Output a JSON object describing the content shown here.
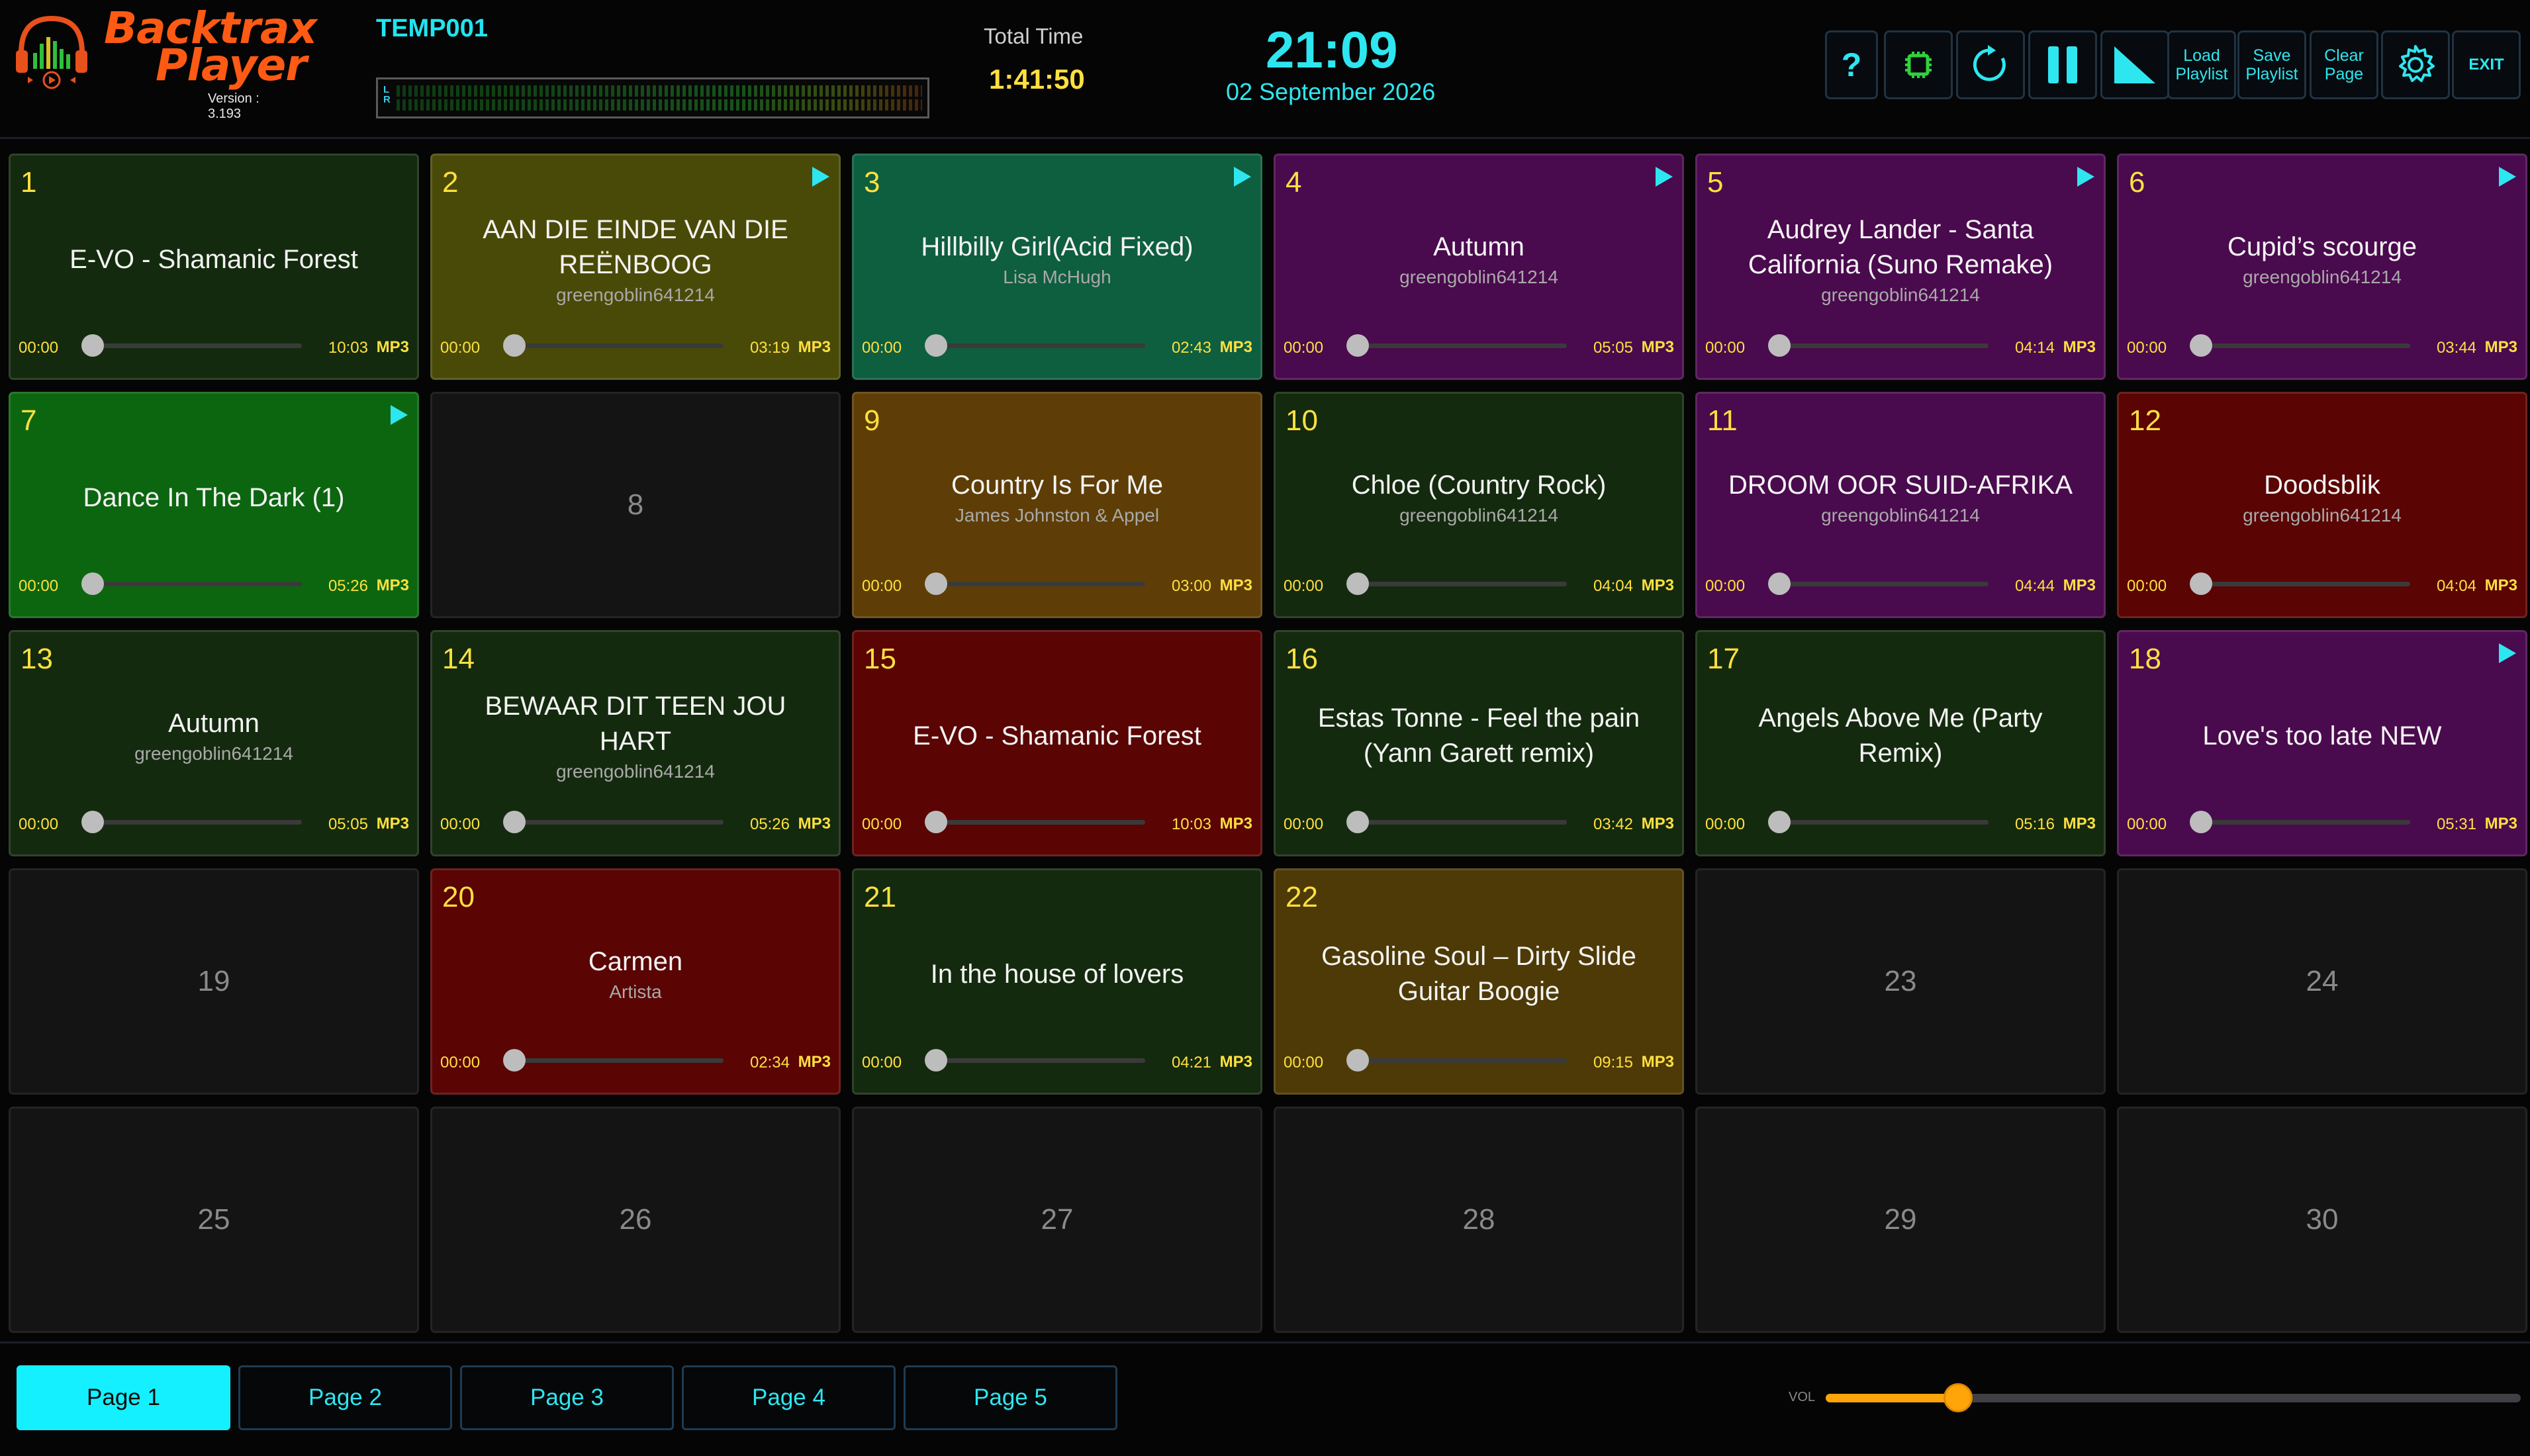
{
  "app": {
    "logo_line1": "Backtrax",
    "logo_line2": "Player",
    "version": "Version : 3.193",
    "playlist_name": "TEMP001",
    "meter_letters": "L\nR"
  },
  "status": {
    "total_time_label": "Total Time",
    "total_time": "1:41:50",
    "clock": "21:09",
    "date": "02 September 2026"
  },
  "toolbar": {
    "help_label": "?",
    "load_playlist": "Load\nPlaylist",
    "save_playlist": "Save\nPlaylist",
    "clear_page": "Clear\nPage",
    "exit": "EXIT",
    "icons": [
      "help-icon",
      "chip-icon",
      "refresh-icon",
      "pause-icon",
      "fade-icon",
      "settings-icon"
    ]
  },
  "colors": {
    "accent": "#2ee6f0",
    "yellow": "#ffe040",
    "volume": "#ffa50a",
    "dark_green": "#142a0e",
    "olive": "#4a4a08",
    "teal": "#0e5e40",
    "purple": "#4a0a4e",
    "bright_green": "#0c6610",
    "brown": "#5e3e06",
    "maroon": "#5a0404"
  },
  "grid": {
    "cells": [
      {
        "num": "1",
        "empty": false,
        "title": "E-VO - Shamanic Forest",
        "artist": "",
        "start": "00:00",
        "end": "10:03",
        "format": "MP3",
        "playing": false,
        "color": "#142a0e"
      },
      {
        "num": "2",
        "empty": false,
        "title": "AAN DIE EINDE VAN DIE REËNBOOG",
        "artist": "greengoblin641214",
        "start": "00:00",
        "end": "03:19",
        "format": "MP3",
        "playing": true,
        "color": "#4a4a08"
      },
      {
        "num": "3",
        "empty": false,
        "title": "Hillbilly Girl(Acid Fixed)",
        "artist": "Lisa McHugh",
        "start": "00:00",
        "end": "02:43",
        "format": "MP3",
        "playing": true,
        "color": "#0e5e40"
      },
      {
        "num": "4",
        "empty": false,
        "title": "Autumn",
        "artist": "greengoblin641214",
        "start": "00:00",
        "end": "05:05",
        "format": "MP3",
        "playing": true,
        "color": "#4a0a4e"
      },
      {
        "num": "5",
        "empty": false,
        "title": "Audrey Lander - Santa California (Suno Remake)",
        "artist": "greengoblin641214",
        "start": "00:00",
        "end": "04:14",
        "format": "MP3",
        "playing": true,
        "color": "#4a0a4e"
      },
      {
        "num": "6",
        "empty": false,
        "title": "Cupid’s scourge",
        "artist": "greengoblin641214",
        "start": "00:00",
        "end": "03:44",
        "format": "MP3",
        "playing": true,
        "color": "#4a0a4e"
      },
      {
        "num": "7",
        "empty": false,
        "title": "Dance In The Dark (1)",
        "artist": "",
        "start": "00:00",
        "end": "05:26",
        "format": "MP3",
        "playing": true,
        "color": "#0c6610"
      },
      {
        "num": "8",
        "empty": true
      },
      {
        "num": "9",
        "empty": false,
        "title": "Country Is For Me",
        "artist": "James Johnston & Appel",
        "start": "00:00",
        "end": "03:00",
        "format": "MP3",
        "playing": false,
        "color": "#5e3e06"
      },
      {
        "num": "10",
        "empty": false,
        "title": "Chloe (Country Rock)",
        "artist": "greengoblin641214",
        "start": "00:00",
        "end": "04:04",
        "format": "MP3",
        "playing": false,
        "color": "#142a0e"
      },
      {
        "num": "11",
        "empty": false,
        "title": "DROOM OOR SUID-AFRIKA",
        "artist": "greengoblin641214",
        "start": "00:00",
        "end": "04:44",
        "format": "MP3",
        "playing": false,
        "color": "#4a0a4e"
      },
      {
        "num": "12",
        "empty": false,
        "title": "Doodsblik",
        "artist": "greengoblin641214",
        "start": "00:00",
        "end": "04:04",
        "format": "MP3",
        "playing": false,
        "color": "#5a0404"
      },
      {
        "num": "13",
        "empty": false,
        "title": "Autumn",
        "artist": "greengoblin641214",
        "start": "00:00",
        "end": "05:05",
        "format": "MP3",
        "playing": false,
        "color": "#142a0e"
      },
      {
        "num": "14",
        "empty": false,
        "title": "BEWAAR DIT TEEN JOU HART",
        "artist": "greengoblin641214",
        "start": "00:00",
        "end": "05:26",
        "format": "MP3",
        "playing": false,
        "color": "#142a0e"
      },
      {
        "num": "15",
        "empty": false,
        "title": "E-VO - Shamanic Forest",
        "artist": "",
        "start": "00:00",
        "end": "10:03",
        "format": "MP3",
        "playing": false,
        "color": "#5a0404"
      },
      {
        "num": "16",
        "empty": false,
        "title": "Estas Tonne - Feel the pain (Yann Garett remix)",
        "artist": "",
        "start": "00:00",
        "end": "03:42",
        "format": "MP3",
        "playing": false,
        "color": "#142a0e"
      },
      {
        "num": "17",
        "empty": false,
        "title": "Angels Above Me (Party Remix)",
        "artist": "",
        "start": "00:00",
        "end": "05:16",
        "format": "MP3",
        "playing": false,
        "color": "#142a0e"
      },
      {
        "num": "18",
        "empty": false,
        "title": "Love's too late NEW",
        "artist": "",
        "start": "00:00",
        "end": "05:31",
        "format": "MP3",
        "playing": true,
        "color": "#4a0a4e"
      },
      {
        "num": "19",
        "empty": true
      },
      {
        "num": "20",
        "empty": false,
        "title": "Carmen",
        "artist": "Artista",
        "start": "00:00",
        "end": "02:34",
        "format": "MP3",
        "playing": false,
        "color": "#5a0404"
      },
      {
        "num": "21",
        "empty": false,
        "title": "In the house of lovers",
        "artist": "",
        "start": "00:00",
        "end": "04:21",
        "format": "MP3",
        "playing": false,
        "color": "#142a0e"
      },
      {
        "num": "22",
        "empty": false,
        "title": "Gasoline Soul – Dirty Slide Guitar Boogie",
        "artist": "",
        "start": "00:00",
        "end": "09:15",
        "format": "MP3",
        "playing": false,
        "color": "#4e3a06"
      },
      {
        "num": "23",
        "empty": true
      },
      {
        "num": "24",
        "empty": true
      },
      {
        "num": "25",
        "empty": true
      },
      {
        "num": "26",
        "empty": true
      },
      {
        "num": "27",
        "empty": true
      },
      {
        "num": "28",
        "empty": true
      },
      {
        "num": "29",
        "empty": true
      },
      {
        "num": "30",
        "empty": true
      }
    ]
  },
  "footer": {
    "pages": [
      {
        "label": "Page 1",
        "active": true
      },
      {
        "label": "Page 2",
        "active": false
      },
      {
        "label": "Page 3",
        "active": false
      },
      {
        "label": "Page 4",
        "active": false
      },
      {
        "label": "Page 5",
        "active": false
      }
    ],
    "volume_label": "VOL",
    "volume_level": 0.19
  }
}
